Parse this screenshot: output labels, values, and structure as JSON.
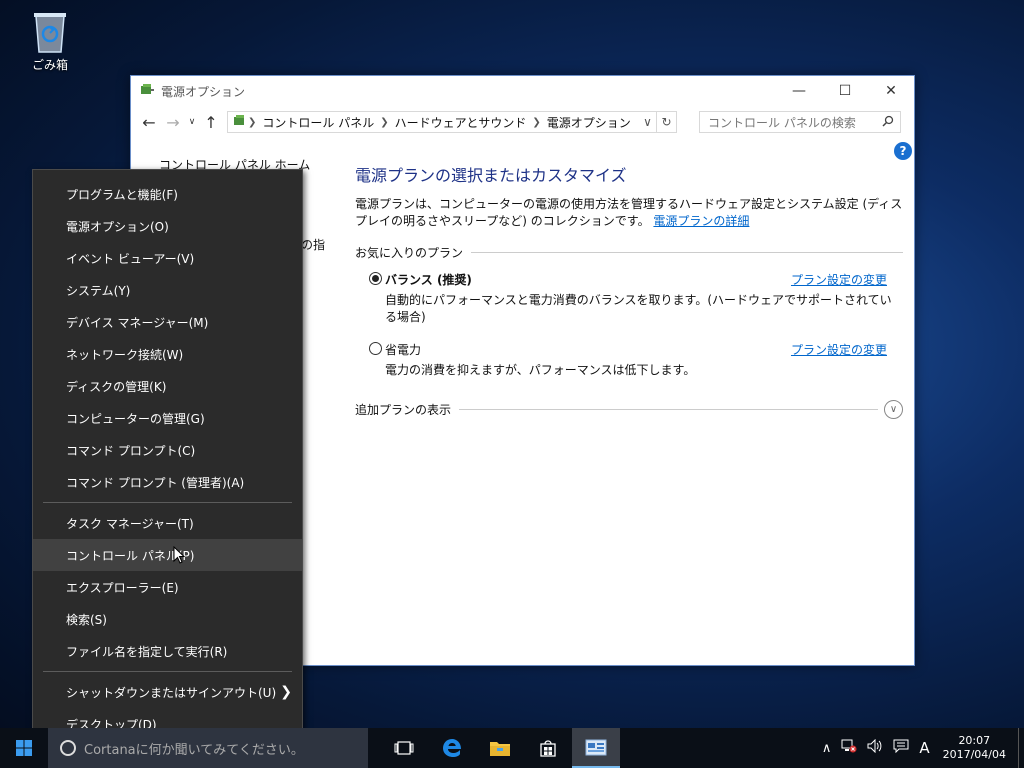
{
  "desktop": {
    "recycle_bin_label": "ごみ箱"
  },
  "window": {
    "title": "電源オプション",
    "breadcrumb": [
      "コントロール パネル",
      "ハードウェアとサウンド",
      "電源オプション"
    ],
    "search_placeholder": "コントロール パネルの検索",
    "left_pane": {
      "home_link": "コントロール パネル ホーム",
      "partial_text": "の指"
    },
    "main": {
      "heading": "電源プランの選択またはカスタマイズ",
      "description": "電源プランは、コンピューターの電源の使用方法を管理するハードウェア設定とシステム設定 (ディスプレイの明るさやスリープなど) のコレクションです。",
      "details_link": "電源プランの詳細",
      "favorites_label": "お気に入りのプラン",
      "plans": [
        {
          "name": "バランス (推奨)",
          "description": "自動的にパフォーマンスと電力消費のバランスを取ります。(ハードウェアでサポートされている場合)",
          "change_link": "プラン設定の変更",
          "selected": true
        },
        {
          "name": "省電力",
          "description": "電力の消費を抑えますが、パフォーマンスは低下します。",
          "change_link": "プラン設定の変更",
          "selected": false
        }
      ],
      "additional_plans_label": "追加プランの表示"
    }
  },
  "context_menu": {
    "group1": [
      "プログラムと機能(F)",
      "電源オプション(O)",
      "イベント ビューアー(V)",
      "システム(Y)",
      "デバイス マネージャー(M)",
      "ネットワーク接続(W)",
      "ディスクの管理(K)",
      "コンピューターの管理(G)",
      "コマンド プロンプト(C)",
      "コマンド プロンプト (管理者)(A)"
    ],
    "group2": [
      "タスク マネージャー(T)",
      "コントロール パネル(P)",
      "エクスプローラー(E)",
      "検索(S)",
      "ファイル名を指定して実行(R)"
    ],
    "group3": [
      "シャットダウンまたはサインアウト(U)",
      "デスクトップ(D)"
    ],
    "hovered_item": "コントロール パネル(P)"
  },
  "taskbar": {
    "cortana_text": "Cortanaに何か聞いてみてください。",
    "ime_indicator": "A",
    "time": "20:07",
    "date": "2017/04/04"
  }
}
